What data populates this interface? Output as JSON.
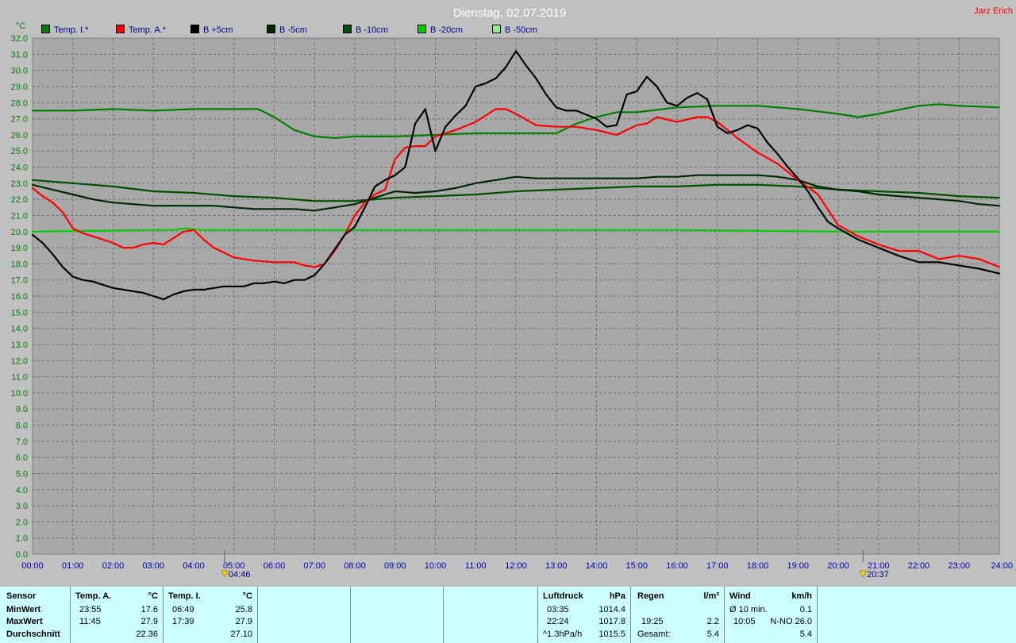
{
  "title": "Dienstag, 02.07.2019",
  "author": "Jarz Erich",
  "chart_data": {
    "type": "line",
    "ylabel": "°C",
    "ylim": [
      0,
      32
    ],
    "y_ticks": [
      "0.0",
      "1.0",
      "2.0",
      "3.0",
      "4.0",
      "5.0",
      "6.0",
      "7.0",
      "8.0",
      "9.0",
      "10.0",
      "11.0",
      "12.0",
      "13.0",
      "14.0",
      "15.0",
      "16.0",
      "17.0",
      "18.0",
      "19.0",
      "20.0",
      "21.0",
      "22.0",
      "23.0",
      "24.0",
      "25.0",
      "26.0",
      "27.0",
      "28.0",
      "29.0",
      "30.0",
      "31.0",
      "32.0"
    ],
    "x_ticks": [
      "00:00",
      "01:00",
      "02:00",
      "03:00",
      "04:00",
      "05:00",
      "06:00",
      "07:00",
      "08:00",
      "09:00",
      "10:00",
      "11:00",
      "12:00",
      "13:00",
      "14:00",
      "15:00",
      "16:00",
      "17:00",
      "18:00",
      "19:00",
      "20:00",
      "21:00",
      "22:00",
      "23:00",
      "24:00"
    ],
    "xlim": [
      0,
      24
    ],
    "grid": true,
    "legend": "top-left",
    "sunrise": {
      "label": "04:46",
      "hour": 4.7667
    },
    "sunset": {
      "label": "20:37",
      "hour": 20.6167
    },
    "series": [
      {
        "name": "Temp. I.*",
        "color": "#008000",
        "swatch": "#008000",
        "x": [
          0,
          1,
          2,
          3,
          4,
          5,
          5.6,
          6,
          6.5,
          7,
          7.5,
          8,
          9,
          10,
          11,
          12,
          13,
          13.5,
          14,
          14.5,
          15,
          16,
          17,
          18,
          19,
          20,
          20.5,
          21,
          22,
          22.5,
          23,
          24
        ],
        "y": [
          27.5,
          27.5,
          27.6,
          27.5,
          27.6,
          27.6,
          27.6,
          27.1,
          26.3,
          25.9,
          25.8,
          25.9,
          25.9,
          26.0,
          26.1,
          26.1,
          26.1,
          26.7,
          27.1,
          27.4,
          27.4,
          27.7,
          27.8,
          27.8,
          27.6,
          27.3,
          27.1,
          27.3,
          27.8,
          27.9,
          27.8,
          27.7
        ]
      },
      {
        "name": "Temp. A.*",
        "color": "#ff0000",
        "swatch": "#ff0000",
        "x": [
          0,
          0.25,
          0.5,
          0.75,
          1,
          1.25,
          1.5,
          2,
          2.25,
          2.5,
          2.75,
          3,
          3.25,
          3.5,
          3.75,
          4,
          4.25,
          4.5,
          4.75,
          5,
          5.5,
          6,
          6.5,
          6.75,
          7,
          7.25,
          7.5,
          7.75,
          8,
          8.25,
          8.5,
          8.75,
          9,
          9.25,
          9.5,
          9.75,
          10,
          10.5,
          11,
          11.25,
          11.5,
          11.75,
          12,
          12.5,
          13,
          13.5,
          14,
          14.5,
          15,
          15.25,
          15.5,
          16,
          16.5,
          16.75,
          17,
          17.5,
          18,
          18.5,
          19,
          19.5,
          20,
          20.5,
          21,
          21.5,
          22,
          22.5,
          23,
          23.5,
          24
        ],
        "y": [
          22.7,
          22.2,
          21.8,
          21.2,
          20.2,
          19.9,
          19.7,
          19.3,
          19.0,
          19.0,
          19.2,
          19.3,
          19.2,
          19.6,
          20.0,
          20.1,
          19.5,
          19.0,
          18.7,
          18.4,
          18.2,
          18.1,
          18.1,
          17.9,
          17.8,
          18.0,
          18.8,
          19.8,
          21.0,
          21.8,
          22.3,
          22.6,
          24.5,
          25.2,
          25.3,
          25.3,
          25.9,
          26.3,
          26.8,
          27.2,
          27.6,
          27.6,
          27.3,
          26.6,
          26.5,
          26.5,
          26.3,
          26.0,
          26.6,
          26.7,
          27.1,
          26.8,
          27.1,
          27.1,
          26.8,
          25.8,
          24.9,
          24.2,
          23.2,
          22.3,
          20.4,
          19.7,
          19.2,
          18.8,
          18.8,
          18.3,
          18.5,
          18.3,
          17.8
        ]
      },
      {
        "name": "B +5cm",
        "color": "#000000",
        "swatch": "#000000",
        "x": [
          0,
          0.25,
          0.5,
          0.75,
          1,
          1.25,
          1.5,
          1.75,
          2,
          2.5,
          2.75,
          3,
          3.25,
          3.5,
          3.75,
          4,
          4.25,
          4.5,
          4.75,
          5,
          5.25,
          5.5,
          5.75,
          6,
          6.25,
          6.5,
          6.75,
          7,
          7.25,
          7.5,
          7.75,
          8,
          8.25,
          8.5,
          8.75,
          9,
          9.25,
          9.5,
          9.75,
          10,
          10.25,
          10.5,
          10.75,
          11,
          11.25,
          11.5,
          11.75,
          12,
          12.25,
          12.5,
          12.75,
          13,
          13.25,
          13.5,
          14,
          14.25,
          14.5,
          14.75,
          15,
          15.25,
          15.5,
          15.75,
          16,
          16.25,
          16.5,
          16.75,
          17,
          17.25,
          17.5,
          17.75,
          18,
          18.25,
          18.5,
          18.75,
          19,
          19.25,
          19.5,
          19.75,
          20,
          20.5,
          21,
          21.5,
          22,
          22.5,
          23,
          23.5,
          24
        ],
        "y": [
          19.8,
          19.3,
          18.6,
          17.8,
          17.2,
          17.0,
          16.9,
          16.7,
          16.5,
          16.3,
          16.2,
          16.0,
          15.8,
          16.1,
          16.3,
          16.4,
          16.4,
          16.5,
          16.6,
          16.6,
          16.6,
          16.8,
          16.8,
          16.9,
          16.8,
          17.0,
          17.0,
          17.3,
          18.0,
          18.9,
          19.8,
          20.3,
          21.5,
          22.8,
          23.2,
          23.5,
          24.0,
          26.7,
          27.6,
          25.0,
          26.5,
          27.2,
          27.8,
          29.0,
          29.2,
          29.5,
          30.2,
          31.2,
          30.3,
          29.5,
          28.5,
          27.7,
          27.5,
          27.5,
          27.0,
          26.5,
          26.6,
          28.5,
          28.7,
          29.6,
          29.0,
          28.0,
          27.8,
          28.3,
          28.6,
          28.2,
          26.5,
          26.1,
          26.3,
          26.6,
          26.4,
          25.5,
          24.8,
          24.0,
          23.3,
          22.5,
          21.5,
          20.6,
          20.2,
          19.5,
          19.0,
          18.5,
          18.1,
          18.1,
          17.9,
          17.7,
          17.4
        ]
      },
      {
        "name": "B -5cm",
        "color": "#002800",
        "swatch": "#002800",
        "x": [
          0,
          0.5,
          1,
          1.5,
          2,
          2.5,
          3,
          3.5,
          4,
          4.5,
          5,
          5.5,
          6,
          6.5,
          7,
          7.5,
          8,
          8.5,
          9,
          9.5,
          10,
          10.5,
          11,
          11.5,
          12,
          12.5,
          13,
          13.5,
          14,
          14.5,
          15,
          15.5,
          16,
          16.5,
          17,
          17.5,
          18,
          18.5,
          19,
          19.5,
          20,
          20.5,
          21,
          21.5,
          22,
          22.5,
          23,
          23.5,
          24
        ],
        "y": [
          22.9,
          22.6,
          22.3,
          22.0,
          21.8,
          21.7,
          21.6,
          21.6,
          21.6,
          21.6,
          21.5,
          21.4,
          21.4,
          21.4,
          21.3,
          21.5,
          21.7,
          22.1,
          22.5,
          22.4,
          22.5,
          22.7,
          23.0,
          23.2,
          23.4,
          23.3,
          23.3,
          23.3,
          23.3,
          23.3,
          23.3,
          23.4,
          23.4,
          23.5,
          23.5,
          23.5,
          23.5,
          23.4,
          23.2,
          22.8,
          22.6,
          22.5,
          22.3,
          22.2,
          22.1,
          22.0,
          21.9,
          21.7,
          21.6
        ]
      },
      {
        "name": "B -10cm",
        "color": "#005000",
        "swatch": "#005000",
        "x": [
          0,
          1,
          2,
          3,
          4,
          5,
          6,
          7,
          8,
          9,
          10,
          11,
          12,
          13,
          14,
          15,
          16,
          17,
          18,
          19,
          20,
          21,
          22,
          23,
          24
        ],
        "y": [
          23.2,
          23.0,
          22.8,
          22.5,
          22.4,
          22.2,
          22.1,
          21.9,
          21.9,
          22.1,
          22.2,
          22.3,
          22.5,
          22.6,
          22.7,
          22.8,
          22.8,
          22.9,
          22.9,
          22.8,
          22.6,
          22.5,
          22.4,
          22.2,
          22.1
        ]
      },
      {
        "name": "B -20cm",
        "color": "#00d000",
        "swatch": "#00d000",
        "x": [
          0,
          3,
          3.5,
          3.8,
          4.2,
          6,
          10,
          15,
          16,
          20,
          24
        ],
        "y": [
          20.0,
          20.1,
          20.1,
          20.2,
          20.1,
          20.1,
          20.1,
          20.1,
          20.1,
          20.0,
          20.0
        ]
      },
      {
        "name": "B -50cm",
        "color": "#90ee90",
        "swatch": "#90ee90",
        "x": [],
        "y": []
      }
    ]
  },
  "stats": {
    "row_labels": {
      "sensor": "Sensor",
      "min": "MinWert",
      "max": "MaxWert",
      "avg": "Durchschnitt"
    },
    "temp_a": {
      "title": "Temp. A.",
      "unit": "°C",
      "min_time": "23:55",
      "min_val": "17.6",
      "max_time": "11:45",
      "max_val": "27.9",
      "avg": "22.36"
    },
    "temp_i": {
      "title": "Temp. I.",
      "unit": "°C",
      "min_time": "06:49",
      "min_val": "25.8",
      "max_time": "17:39",
      "max_val": "27.9",
      "avg": "27.10"
    },
    "pressure": {
      "title": "Luftdruck",
      "unit": "hPa",
      "min_time": "03:35",
      "min_val": "1014.4",
      "max_time": "22:24",
      "max_val": "1017.8",
      "avg_label": "^1.3hPa/h",
      "avg": "1015.5"
    },
    "rain": {
      "title": "Regen",
      "unit": "l/m²",
      "max_time": "19:25",
      "max_val": "2.2",
      "total_label": "Gesamt:",
      "total": "5.4"
    },
    "wind": {
      "title": "Wind",
      "unit": "km/h",
      "min_label": "Ø 10 min.",
      "min_val": "0.1",
      "max_time": "10:05",
      "max_val": "N-NO 26.0",
      "avg": "5.4"
    }
  }
}
